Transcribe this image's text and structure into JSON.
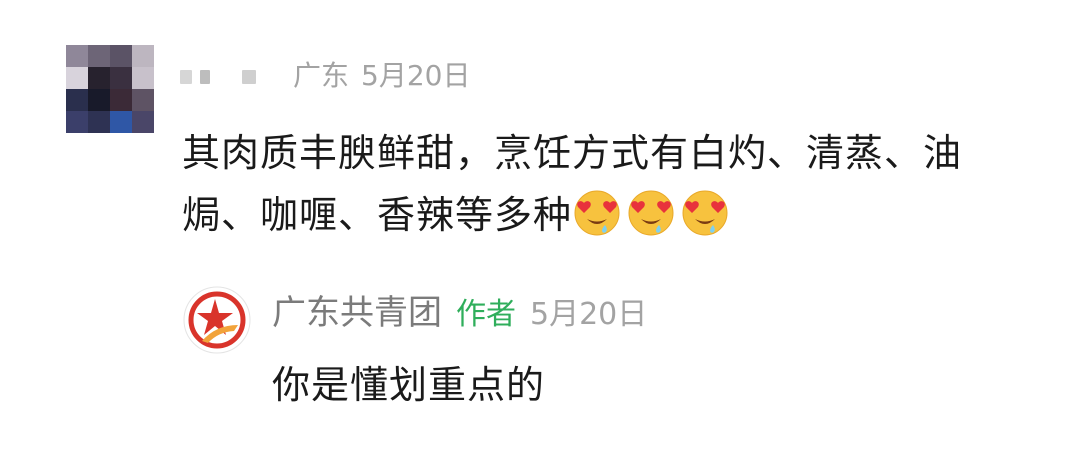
{
  "comment": {
    "avatar": "blurred-avatar",
    "username": "blurred-username",
    "location": "广东",
    "date": "5月20日",
    "text": "其肉质丰腴鲜甜，烹饪方式有白灼、清蒸、油焗、咖喱、香辣等多种",
    "emojis": [
      "heart-eyes-drooling-face-emoji",
      "heart-eyes-drooling-face-emoji",
      "heart-eyes-drooling-face-emoji"
    ]
  },
  "reply": {
    "avatar": "guangdong-youth-league-logo",
    "username": "广东共青团",
    "author_tag": "作者",
    "date": "5月20日",
    "text": "你是懂划重点的"
  },
  "colors": {
    "meta_gray": "#a3a3a3",
    "name_gray": "#7b7b7b",
    "author_green": "#2fae5b",
    "text": "#1a1a1a",
    "logo_red": "#d9342b"
  }
}
